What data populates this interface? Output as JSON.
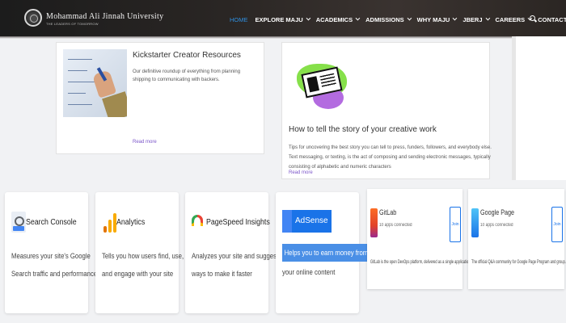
{
  "header": {
    "brand": "Mohammad Ali Jinnah University",
    "brand_sub": "THE LEADERS OF TOMORROW",
    "menu": [
      {
        "label": "HOME",
        "dropdown": false
      },
      {
        "label": "EXPLORE MAJU",
        "dropdown": true
      },
      {
        "label": "ACADEMICS",
        "dropdown": true
      },
      {
        "label": "ADMISSIONS",
        "dropdown": true
      },
      {
        "label": "WHY MAJU",
        "dropdown": true
      },
      {
        "label": "JBERJ",
        "dropdown": true
      },
      {
        "label": "CAREERS",
        "dropdown": true
      },
      {
        "label": "CONTACT",
        "dropdown": false
      }
    ],
    "search_icon": "search-icon"
  },
  "articles": [
    {
      "title": "Kickstarter Creator Resources",
      "excerpt": "Our definitive roundup of everything from planning shipping to communicating with backers.",
      "read_more": "Read more"
    },
    {
      "title": "How to tell the story of your creative work",
      "excerpt": "Tips for uncovering the best story you can tell to press, funders, followers, and everybody else. Text messaging, or texting, is the act of composing and sending electronic messages, typically consisting of alphabetic and numeric characters",
      "read_more": "Read more"
    }
  ],
  "tools": [
    {
      "name": "Search Console",
      "desc1": "Measures your site's Google",
      "desc2": "Search traffic and performance"
    },
    {
      "name": "Analytics",
      "desc1": "Tells you how users find, use,",
      "desc2": "and engage with your site"
    },
    {
      "name": "PageSpeed Insights",
      "desc1": "Analyzes your site and suggests",
      "desc2": "ways to make it faster"
    },
    {
      "name": "AdSense",
      "desc1": "Helps you to earn money from",
      "desc2": "your online content"
    }
  ],
  "projects": [
    {
      "name": "GitLab",
      "meta": "10 apps connected",
      "join": "Join",
      "desc": "GitLab is the open DevOps platform, delivered as a single application. Developers..."
    },
    {
      "name": "Google Page",
      "meta": "10 apps connected",
      "join": "Join",
      "desc": "The official Q&A community for Google Page Program and group..."
    }
  ],
  "colors": {
    "accent": "#2f8fe0",
    "read_more": "#7b55c9",
    "gitlab": "#e24329",
    "google_blue": "#1a73e8"
  }
}
